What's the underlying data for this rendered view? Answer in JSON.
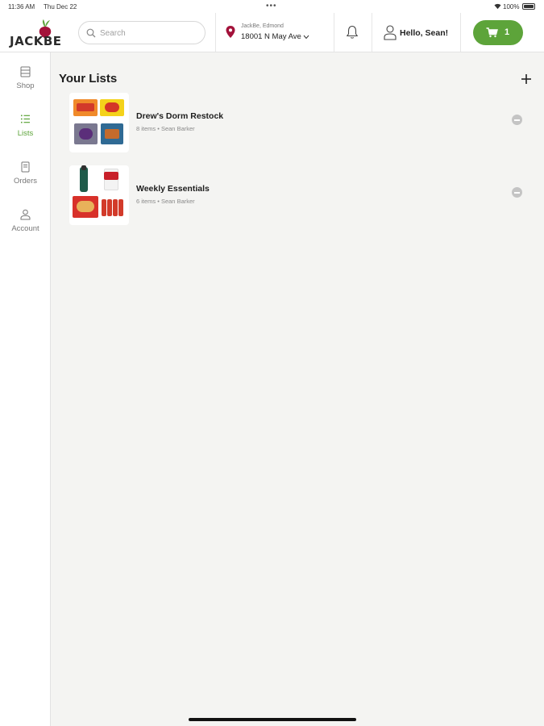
{
  "status_bar": {
    "time": "11:36 AM",
    "date": "Thu Dec 22",
    "dots": "•••",
    "battery": "100%"
  },
  "header": {
    "logo_text": "JACKBE",
    "search_placeholder": "Search",
    "store_name": "JackBe, Edmond",
    "store_address": "18001 N May Ave",
    "greeting": "Hello, Sean!",
    "cart_count": "1"
  },
  "sidebar": {
    "items": [
      {
        "label": "Shop",
        "icon": "store-icon",
        "active": false
      },
      {
        "label": "Lists",
        "icon": "list-icon",
        "active": true
      },
      {
        "label": "Orders",
        "icon": "receipt-icon",
        "active": false
      },
      {
        "label": "Account",
        "icon": "person-icon",
        "active": false
      }
    ]
  },
  "main": {
    "title": "Your Lists",
    "lists": [
      {
        "name": "Drew's Dorm Restock",
        "meta": "8 items • Sean Barker"
      },
      {
        "name": "Weekly Essentials",
        "meta": "6 items • Sean Barker"
      }
    ]
  },
  "colors": {
    "accent_green": "#5da43a",
    "brand_beet": "#a3123a",
    "background": "#f4f4f2"
  }
}
